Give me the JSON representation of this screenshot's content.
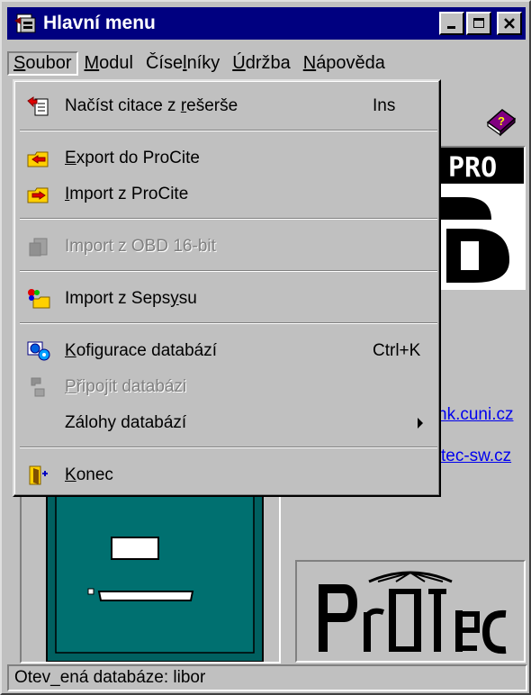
{
  "window": {
    "title": "Hlavní menu"
  },
  "menubar": {
    "items": [
      {
        "pre": "",
        "key": "S",
        "post": "oubor"
      },
      {
        "pre": "",
        "key": "M",
        "post": "odul"
      },
      {
        "pre": "Číse",
        "key": "l",
        "post": "níky"
      },
      {
        "pre": "",
        "key": "Ú",
        "post": "držba"
      },
      {
        "pre": "",
        "key": "N",
        "post": "ápověda"
      }
    ]
  },
  "file_menu": {
    "load": {
      "pre": "Načíst citace z ",
      "key": "r",
      "post": "ešerše",
      "shortcut": "Ins"
    },
    "export": {
      "pre": "",
      "key": "E",
      "post": "xport do ProCite"
    },
    "import_procite": {
      "pre": "",
      "key": "I",
      "post": "mport z ProCite"
    },
    "import_obd": {
      "pre": "Import z OBD 16-bit"
    },
    "import_sepsys": {
      "pre": "Import z Seps",
      "key": "y",
      "post": "su"
    },
    "config": {
      "pre": "",
      "key": "K",
      "post": "ofigurace databází",
      "shortcut": "Ctrl+K"
    },
    "connect": {
      "pre": "",
      "key": "P",
      "post": "řipojit databázi"
    },
    "backup": {
      "pre": "Zálohy databází"
    },
    "exit": {
      "pre": "",
      "key": "K",
      "post": "onec"
    }
  },
  "background": {
    "link1": "nk.cuni.cz",
    "link2": "tec-sw.cz",
    "logo_text": "PRO"
  },
  "statusbar": {
    "text": "Otev_ená databáze: libor"
  }
}
